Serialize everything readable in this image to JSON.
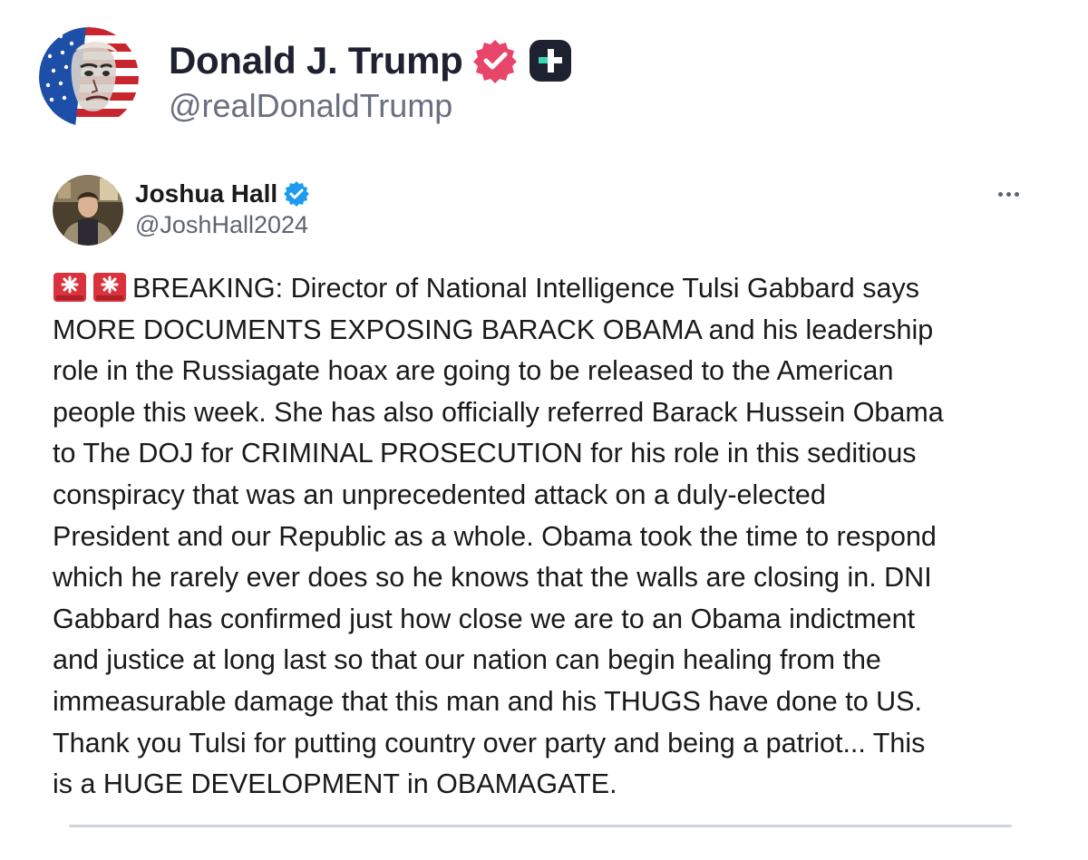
{
  "outer_post": {
    "display_name": "Donald J. Trump",
    "handle": "@realDonaldTrump",
    "avatar_icon": "flag-portrait-avatar",
    "verified_icon": "verified-badge-icon",
    "plus_icon": "plus-icon",
    "accent_color": "#e8456b"
  },
  "quoted_post": {
    "display_name": "Joshua Hall",
    "handle": "@JoshHall2024",
    "verified_icon": "verified-badge-icon",
    "verified_color": "#1d9bf0",
    "more_icon": "more-options-icon",
    "lead_icons": [
      "siren-emoji-icon",
      "siren-emoji-icon"
    ],
    "lines": [
      "BREAKING: Director of National Intelligence Tulsi Gabbard says",
      "MORE DOCUMENTS EXPOSING BARACK OBAMA and his leadership",
      "role in the Russiagate hoax are going to be released to the American",
      "people this week. She has also officially referred Barack Hussein Obama",
      "to The DOJ for CRIMINAL PROSECUTION for his role in this seditious",
      "conspiracy that was an unprecedented attack on a duly-elected",
      "President and our Republic as a whole. Obama took the time to respond",
      "which he rarely ever does so he knows that the walls are closing in. DNI",
      "Gabbard has confirmed just how close we are to an Obama indictment",
      "and justice at long last so that our nation can begin healing from the",
      "immeasurable damage that this man and his THUGS have done to US.",
      "Thank you Tulsi for putting country over party and being a patriot... This",
      "is a HUGE DEVELOPMENT in OBAMAGATE."
    ]
  }
}
